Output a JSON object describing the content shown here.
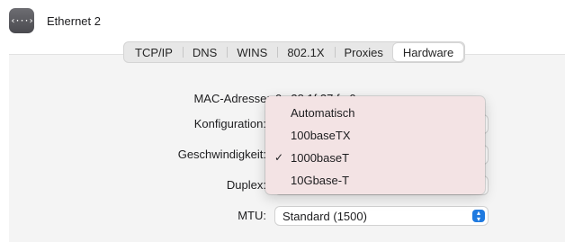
{
  "window": {
    "title": "Ethernet 2",
    "icon": "ethernet-icon",
    "icon_glyph": "‹···›"
  },
  "tabs": [
    {
      "label": "TCP/IP"
    },
    {
      "label": "DNS"
    },
    {
      "label": "WINS"
    },
    {
      "label": "802.1X"
    },
    {
      "label": "Proxies"
    },
    {
      "label": "Hardware",
      "active": true
    }
  ],
  "form": {
    "mac_label": "MAC-Adresse:",
    "mac_value": "0c:38:1f:37:fa:0c",
    "config_label": "Konfiguration:",
    "speed_label": "Geschwindigkeit:",
    "duplex_label": "Duplex:",
    "mtu_label": "MTU:",
    "mtu_value": "Standard (1500)"
  },
  "speed_menu": {
    "items": [
      {
        "label": "Automatisch",
        "checked": false
      },
      {
        "label": "100baseTX",
        "checked": false
      },
      {
        "label": "1000baseT",
        "checked": true
      },
      {
        "label": "10Gbase-T",
        "checked": false
      }
    ],
    "check_glyph": "✓"
  },
  "colors": {
    "accent": "#1f7ae0",
    "menu_background": "#f3e3e4",
    "panel_background": "#f4f4f4"
  }
}
